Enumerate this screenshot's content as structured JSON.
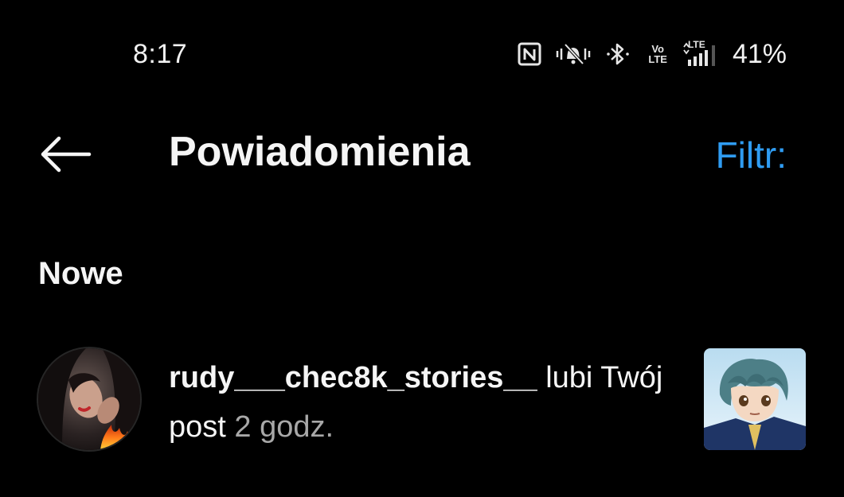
{
  "status_bar": {
    "time": "8:17",
    "battery_percent": "41%",
    "icons": [
      "nfc-icon",
      "mute-icon",
      "bluetooth-icon",
      "volte-icon",
      "lte-signal-icon"
    ],
    "volte_line1": "Vo",
    "volte_line2": "LTE",
    "network_label": "LTE"
  },
  "header": {
    "back_icon": "arrow-left-icon",
    "title": "Powiadomienia",
    "filter_label": "Filtr:"
  },
  "colors": {
    "background": "#000000",
    "text": "#f5f5f5",
    "accent": "#2f9cf2",
    "muted": "#a8a8a8"
  },
  "sections": [
    {
      "title": "Nowe",
      "notifications": [
        {
          "username": "rudy___chec8k_stories__",
          "action": " lubi Twój post",
          "time": " 2 godz.",
          "avatar_icon": "user-avatar",
          "thumbnail_icon": "post-thumbnail"
        }
      ]
    }
  ]
}
